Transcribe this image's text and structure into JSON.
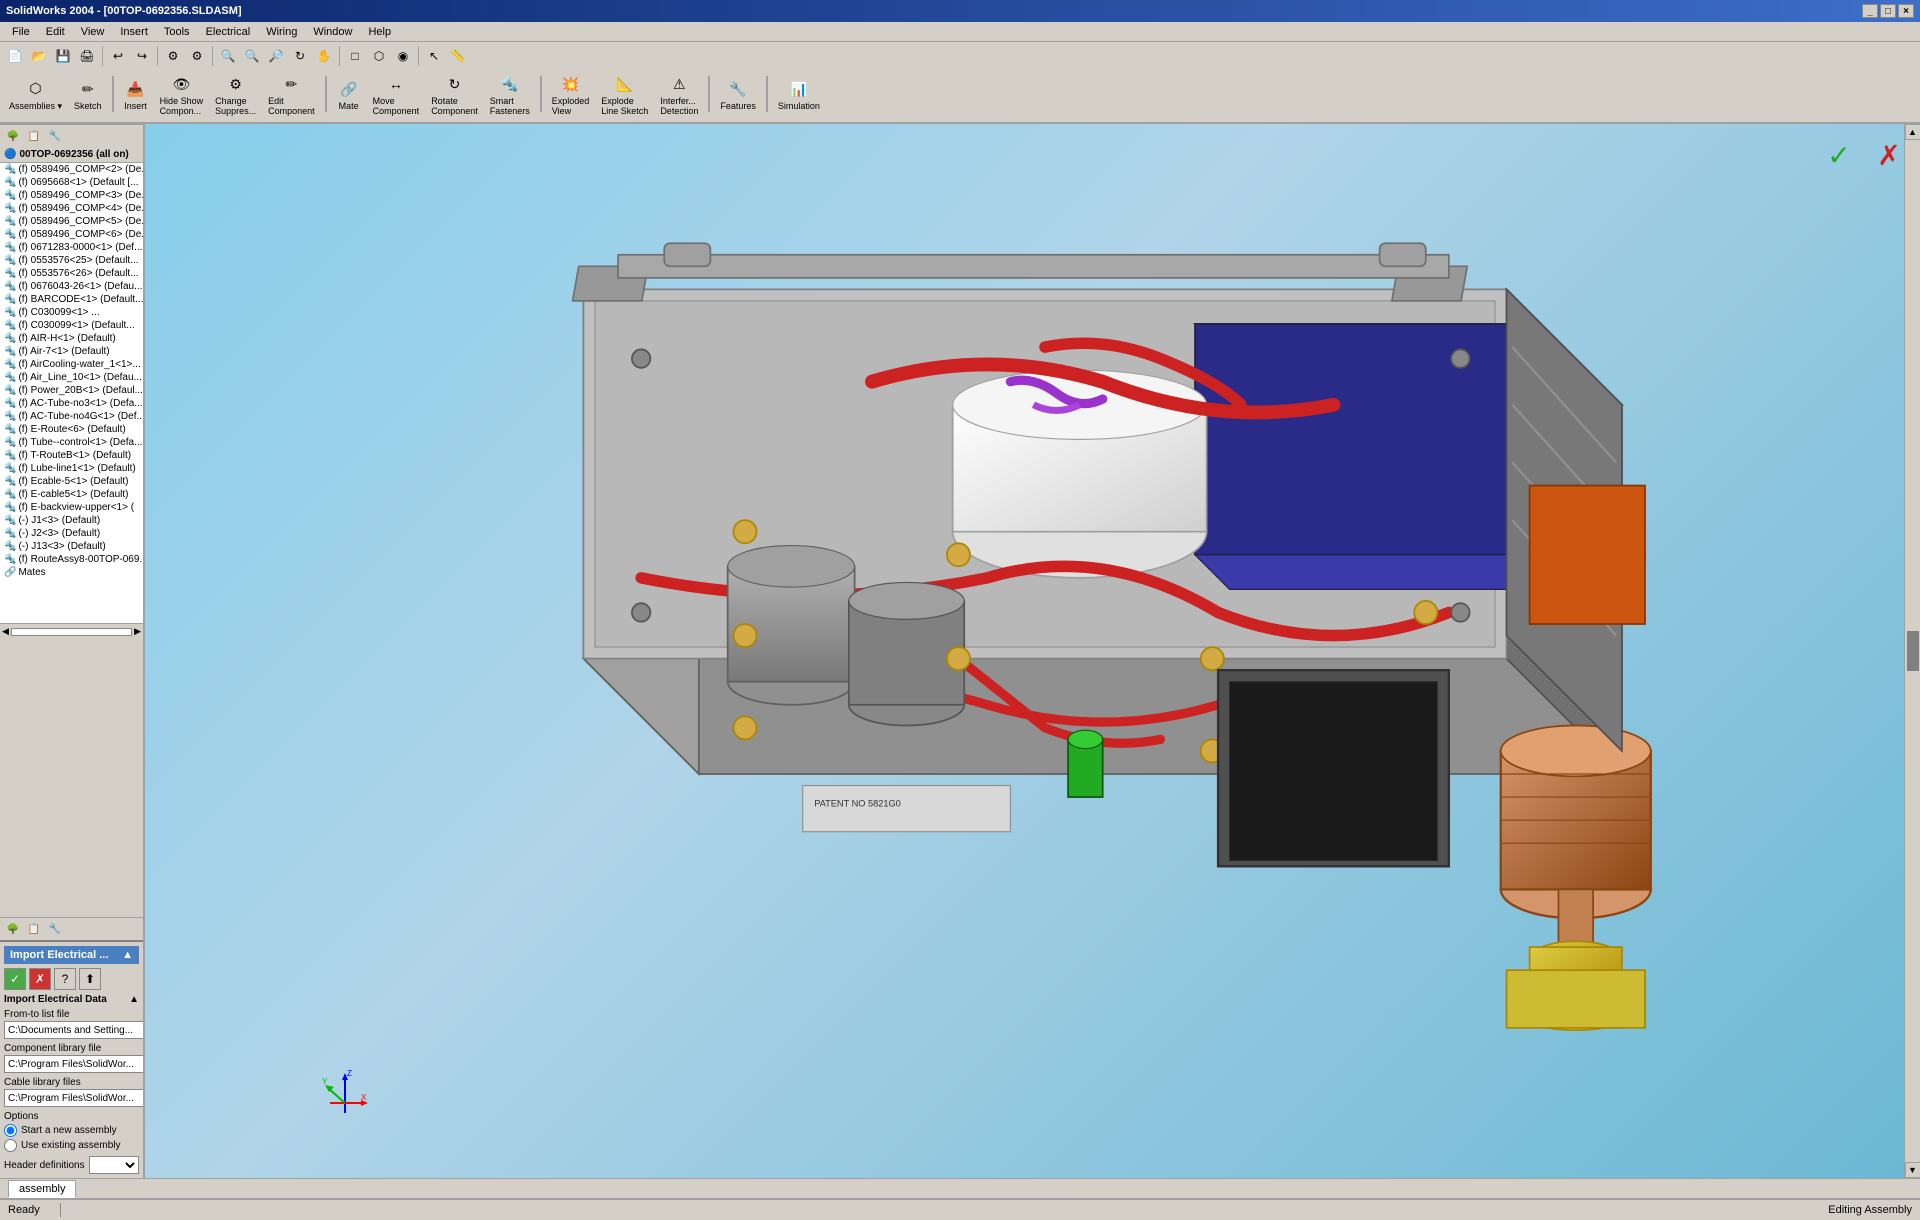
{
  "titlebar": {
    "title": "SolidWorks 2004 - [00TOP-0692356.SLDASM]",
    "controls": [
      "_",
      "□",
      "×"
    ]
  },
  "menubar": {
    "items": [
      "File",
      "Edit",
      "View",
      "Insert",
      "Tools",
      "Electrical",
      "Wiring",
      "Window",
      "Help"
    ]
  },
  "toolbar1": {
    "buttons": [
      {
        "label": "Assemblies",
        "icon": "⬡"
      },
      {
        "label": "Sketch",
        "icon": "✏"
      },
      {
        "label": "Insert",
        "icon": "📥"
      },
      {
        "label": "Hide/Show\nCompon...",
        "icon": "👁"
      },
      {
        "label": "Change\nSuppres...",
        "icon": "⚙"
      },
      {
        "label": "Edit\nComponent",
        "icon": "✏"
      },
      {
        "label": "Mate",
        "icon": "🔗"
      },
      {
        "label": "Move\nComponent",
        "icon": "↔"
      },
      {
        "label": "Rotate\nComponent",
        "icon": "↻"
      },
      {
        "label": "Smart\nFasteners",
        "icon": "🔩"
      },
      {
        "label": "Exploded\nView",
        "icon": "💥"
      },
      {
        "label": "Explode\nLine Sketch",
        "icon": "📐"
      },
      {
        "label": "Interfer...\nDetection",
        "icon": "⚠"
      },
      {
        "label": "Features",
        "icon": "🔧"
      },
      {
        "label": "Simulation",
        "icon": "📊"
      }
    ]
  },
  "tree": {
    "root_label": "00TOP-0692356 (all on)",
    "items": [
      {
        "text": "(f) 0589496_COMP<2> (De..."
      },
      {
        "text": "(f) 0695668<1> (Default [..."
      },
      {
        "text": "(f) 0589496_COMP<3> (De..."
      },
      {
        "text": "(f) 0589496_COMP<4> (De..."
      },
      {
        "text": "(f) 0589496_COMP<5> (De..."
      },
      {
        "text": "(f) 0589496_COMP<6> (De..."
      },
      {
        "text": "(f) 0671283-0000<1> (Def..."
      },
      {
        "text": "(f) 0553576<25> (Default..."
      },
      {
        "text": "(f) 0553576<26> (Default..."
      },
      {
        "text": "(f) 0676043-26<1> (Defau..."
      },
      {
        "text": "(f) BARCODE<1> (Default..."
      },
      {
        "text": "(f) C030099<1> ..."
      },
      {
        "text": "(f) C030099<1> (Default..."
      },
      {
        "text": "(f) AIR-H<1> (Default)"
      },
      {
        "text": "(f) Air-7<1> (Default)"
      },
      {
        "text": "(f) AirCooling-water_1<1>..."
      },
      {
        "text": "(f) Air_Line_10<1> (Defau..."
      },
      {
        "text": "(f) Power_20B<1> (Defaul..."
      },
      {
        "text": "(f) AC-Tube-no3<1> (Defa..."
      },
      {
        "text": "(f) AC-Tube-no4G<1> (Def..."
      },
      {
        "text": "(f) E-Route<6> (Default)"
      },
      {
        "text": "(f) Tube--control<1> (Defa..."
      },
      {
        "text": "(f) T-RouteB<1> (Default)"
      },
      {
        "text": "(f) Lube-line1<1> (Default)"
      },
      {
        "text": "(f) Ecable-5<1> (Default)"
      },
      {
        "text": "(f) E-cable5<1> (Default)"
      },
      {
        "text": "(f) E-backview-upper<1> ("
      },
      {
        "text": "(-) J1<3> (Default)"
      },
      {
        "text": "(-) J2<3> (Default)"
      },
      {
        "text": "(-) J13<3> (Default)"
      },
      {
        "text": "(f) RouteAssy8-00TOP-069..."
      },
      {
        "text": "Mates"
      }
    ]
  },
  "import_panel": {
    "title": "Import Electrical ...",
    "buttons": [
      {
        "icon": "✓",
        "type": "green"
      },
      {
        "icon": "✗",
        "type": "red"
      },
      {
        "icon": "?",
        "type": "normal"
      },
      {
        "icon": "⬆",
        "type": "normal"
      }
    ],
    "sections": [
      {
        "label": "Import Electrical Data",
        "expanded": true
      },
      {
        "label": "From-to list file"
      },
      {
        "label": "Component library file"
      },
      {
        "label": "Cable library files"
      }
    ],
    "from_file_value": "C:\\Documents and Setting...",
    "component_lib": "C:\\Program Files\\SolidWor...",
    "cable_lib": "C:\\Program Files\\SolidWor...",
    "options_label": "Options",
    "radio1": {
      "label": "Start a new assembly",
      "checked": true
    },
    "radio2": {
      "label": "Use existing assembly",
      "checked": false
    },
    "dropdown_label": "Header definitions",
    "dropdown_value": ""
  },
  "statusbar": {
    "left": "Ready",
    "right": "Editing Assembly"
  },
  "bottom_tab": {
    "label": "assembly"
  },
  "viewport": {
    "background_color1": "#87ceeb",
    "background_color2": "#6bb8d4"
  },
  "triad": {
    "x_color": "#ff0000",
    "y_color": "#00bb00",
    "z_color": "#0000ff"
  }
}
